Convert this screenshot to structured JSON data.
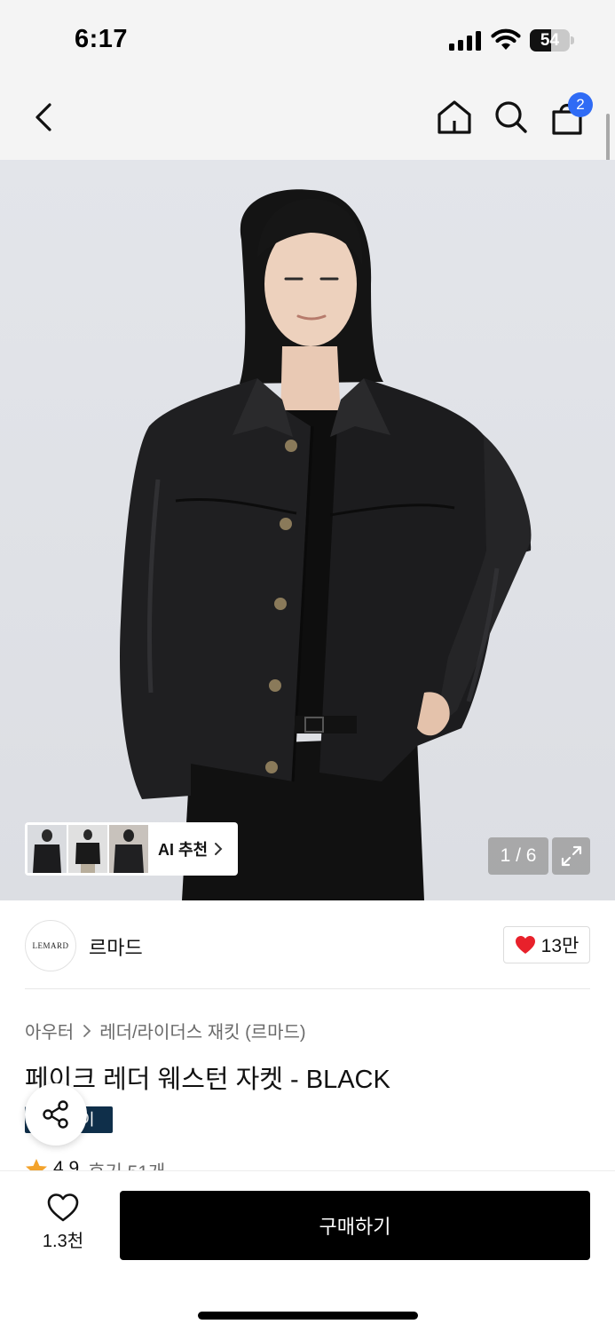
{
  "status_bar": {
    "time": "6:17",
    "battery": "54",
    "battery_level": 0.54
  },
  "nav": {
    "cart_badge": "2"
  },
  "hero": {
    "page_counter": "1 / 6",
    "ai_recommend_label": "AI 추천"
  },
  "brand": {
    "logo_text": "LEMARD",
    "name": "르마드",
    "likes": "13만"
  },
  "product": {
    "breadcrumb": [
      "아우터",
      "레더/라이더스 재킷 (르마드)"
    ],
    "title": "페이크 레더 웨스턴 자켓 - BLACK",
    "promo_badge": "이",
    "rating": "4.9",
    "reviews": "후기 51개"
  },
  "bottom_bar": {
    "wishlist_count": "1.3천",
    "buy_label": "구매하기"
  },
  "colors": {
    "accent_blue": "#2f6bf5",
    "heart_red": "#e8212b",
    "star_orange": "#f3a32c",
    "badge_navy": "#0f2f4a"
  }
}
